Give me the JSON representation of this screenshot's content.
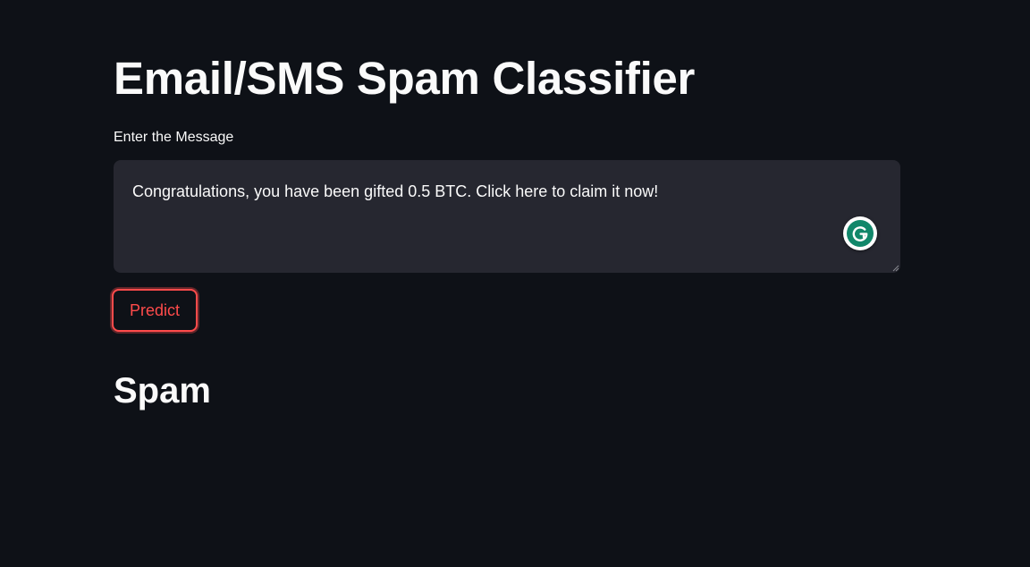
{
  "app": {
    "title": "Email/SMS Spam Classifier"
  },
  "form": {
    "message_label": "Enter the Message",
    "message_value": "Congratulations, you have been gifted 0.5 BTC. Click here to claim it now!",
    "predict_label": "Predict"
  },
  "result": {
    "prediction": "Spam"
  },
  "icons": {
    "grammarly": "grammarly-icon",
    "resize": "resize-handle-icon"
  },
  "colors": {
    "background": "#0e1117",
    "input_background": "#262730",
    "accent": "#ff4b4b",
    "text": "#fafafa",
    "grammarly": "#11876a"
  }
}
